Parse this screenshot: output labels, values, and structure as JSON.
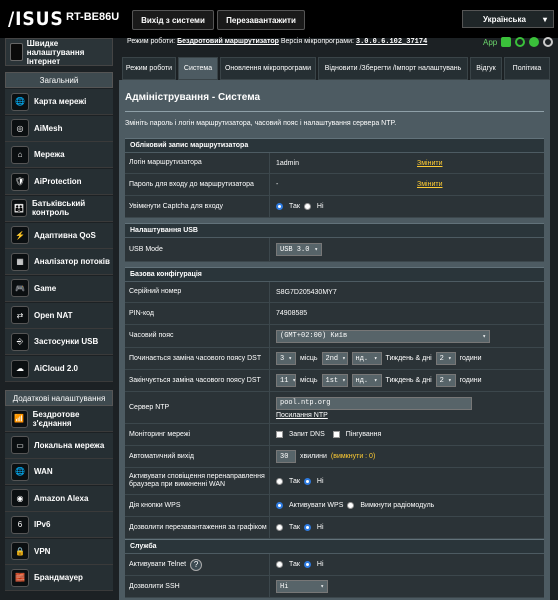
{
  "header": {
    "brand": "/ISUS",
    "model": "RT-BE86U",
    "logout": "Вихід з системи",
    "reboot": "Перезавантажити",
    "language": "Українська",
    "mode_label": "Режим роботи:",
    "mode_value": "Бездротовий маршрутизатор",
    "fw_label": "Версія мікропрограми:",
    "fw_value": "3.0.0.6.102_37174",
    "app_label": "App"
  },
  "sidebar": {
    "quick": "Швидке налаштування Інтернет",
    "general_title": "Загальний",
    "general": [
      "Карта мережі",
      "AiMesh",
      "Мережа",
      "AiProtection",
      "Батьківський контроль",
      "Адаптивна QoS",
      "Аналізатор потоків",
      "Game",
      "Open NAT",
      "Застосунки USB",
      "AiCloud 2.0"
    ],
    "advanced_title": "Додаткові налаштування",
    "advanced": [
      "Бездротове з'єднання",
      "Локальна мережа",
      "WAN",
      "Amazon Alexa",
      "IPv6",
      "VPN",
      "Брандмауер"
    ]
  },
  "tabs": [
    "Режим роботи",
    "Система",
    "Оновлення мікропрограми",
    "Відновити /Зберегти /Імпорт налаштувань",
    "Відгук",
    "Політика"
  ],
  "page": {
    "title": "Адміністрування - Система",
    "desc": "Змініть пароль і логін маршрутизатора, часовий пояс і налаштування сервера NTP."
  },
  "account": {
    "title": "Обліковий запис маршрутизатора",
    "login_label": "Логін маршрутизатора",
    "login_value": "1admin",
    "change": "Змінити",
    "pwd_label": "Пароль для входу до маршрутизатора",
    "pwd_value": "-",
    "captcha_label": "Увімкнути Captcha для входу",
    "yes": "Так",
    "no": "Ні"
  },
  "usb": {
    "title": "Налаштування USB",
    "mode_label": "USB Mode",
    "mode_value": "USB 3.0"
  },
  "basic": {
    "title": "Базова конфігурація",
    "serial_label": "Серійний номер",
    "serial_value": "S8G7D205430MY7",
    "pin_label": "PIN-код",
    "pin_value": "74908585",
    "tz_label": "Часовий пояс",
    "tz_value": "(GMT+02:00) Київ",
    "dst_start_label": "Починається заміна часового поясу DST",
    "dst_start": [
      "3",
      "2nd",
      "нд.",
      " 2"
    ],
    "dst_end_label": "Закінчується заміна часового поясу DST",
    "dst_end": [
      "11",
      "1st",
      "нд.",
      " 2"
    ],
    "month": "місць",
    "week_day": "Тиждень & дні",
    "hours": "години",
    "ntp_label": "Сервер NTP",
    "ntp_value": "pool.ntp.org",
    "ntp_link": "Посилання NTP",
    "monitor_label": "Моніторинг мережі",
    "dns_probe": "Запит DNS",
    "ping": "Пінгування",
    "logout_label": "Автоматичний вихід",
    "logout_value": "30",
    "logout_unit": "хвилини",
    "logout_hint": "(вимкнути : 0)",
    "notify_label": "Активувати сповіщення перенаправлення браузера при вимкненні WAN",
    "wps_label": "Дія кнопки WPS",
    "wps_on": "Активувати WPS",
    "wps_radio": "Вимкнути радіомодуль",
    "sched_label": "Дозволити перезавантаження за графіком"
  },
  "service": {
    "title": "Служба",
    "telnet_label": "Активувати Telnet",
    "ssh_label": "Дозволити SSH",
    "ssh_value": "Ні"
  }
}
